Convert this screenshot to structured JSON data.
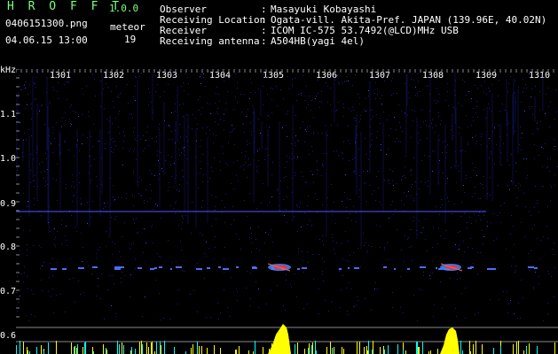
{
  "header": {
    "app_name": "H R O F F T",
    "version": "1.0.0",
    "filename": "0406151300.png",
    "meteor_label": "meteor",
    "meteor_count": "19",
    "datetime": "04.06.15 13:00",
    "info_labels": [
      "Observer",
      "Receiving Location",
      "Receiver",
      "Receiving antenna"
    ],
    "info_colons": [
      ":",
      ":",
      ":",
      ":"
    ],
    "info_values": [
      "Masayuki Kobayashi",
      "Ogata-vill. Akita-Pref. JAPAN (139.96E, 40.02N)",
      "ICOM IC-575 53.7492(@LCD)MHz USB",
      "A504HB(yagi 4el)"
    ]
  },
  "axis": {
    "unit": "kHz",
    "y_ticks": [
      "1.1",
      "1.0",
      "0.9",
      "0.8",
      "0.7",
      "0.6"
    ],
    "x_ticks": [
      "1301",
      "1302",
      "1303",
      "1304",
      "1305",
      "1306",
      "1307",
      "1308",
      "1309",
      "1310"
    ]
  },
  "colors": {
    "background": "#000000",
    "noise": "#1a1a8c",
    "carrier_line": "#4a5cff",
    "meteor_core": "#ff3030",
    "meteor_halo": "#4488ff",
    "histogram": "#ffff00",
    "histogram_alt": "#00ffff",
    "header_green": "#7dff7d"
  }
}
